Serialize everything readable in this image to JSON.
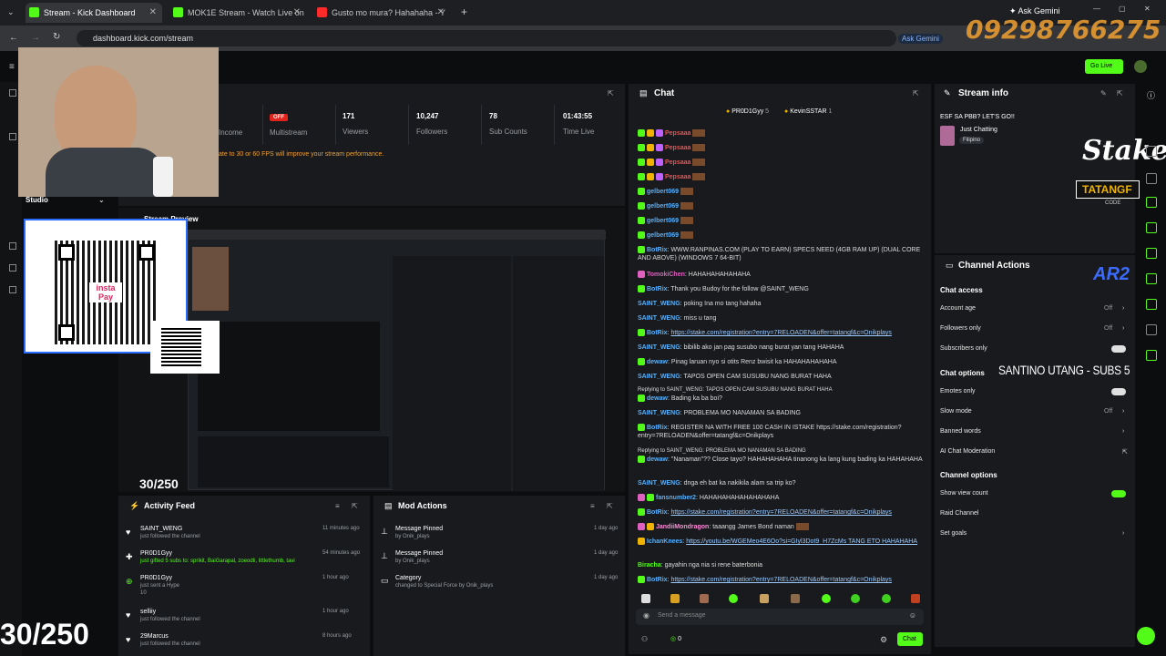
{
  "browser": {
    "tabs": [
      {
        "title": "Stream - Kick Dashboard"
      },
      {
        "title": "MOK1E Stream - Watch Live on"
      },
      {
        "title": "Gusto mo mura? Hahahaha - Y"
      }
    ],
    "url": "dashboard.kick.com/stream",
    "ask_gemini": "Ask Gemini",
    "ask_gemini_small": "Ask Gemini"
  },
  "overlay": {
    "phone": "09298766275",
    "qr_brand": "insta Pay",
    "counter_big": "30/250",
    "counter_small": "30/250",
    "stake": "Stake",
    "tatang": "TATANGF",
    "code": "CODE",
    "santino": "SANTINO UTANG - SUBS 5",
    "studio": "Studio"
  },
  "header": {
    "go_live": "Go Live"
  },
  "stats": [
    {
      "value": "",
      "label": "Income"
    },
    {
      "value": "OFF",
      "label": "Multistream"
    },
    {
      "value": "171",
      "label": "Viewers"
    },
    {
      "value": "10,247",
      "label": "Followers"
    },
    {
      "value": "78",
      "label": "Sub Counts"
    },
    {
      "value": "01:43:55",
      "label": "Time Live"
    }
  ],
  "warning": "ate to 30 or 60 FPS will improve your stream performance.",
  "preview": {
    "title": "Stream Preview"
  },
  "chat": {
    "title": "Chat",
    "pinned_users": [
      "PR0D1Gyy",
      "KevinSSTAR"
    ],
    "pinned_counts": [
      "5",
      "1"
    ],
    "messages": [
      {
        "user": "Pepsaaa",
        "text": ""
      },
      {
        "user": "Pepsaaa",
        "text": ""
      },
      {
        "user": "Pepsaaa",
        "text": ""
      },
      {
        "user": "Pepsaaa",
        "text": ""
      },
      {
        "user": "gelbert069",
        "text": ""
      },
      {
        "user": "gelbert069",
        "text": ""
      },
      {
        "user": "gelbert069",
        "text": ""
      },
      {
        "user": "gelbert069",
        "text": ""
      },
      {
        "user": "BotRix",
        "text": "WWW.RANPINAS.COM (PLAY TO EARN) SPECS NEED (4GB RAM UP) (DUAL CORE AND ABOVE) (WINDOWS 7 64-BIT)"
      },
      {
        "user": "TomokiChen",
        "text": "HAHAHAHAHAHAHA"
      },
      {
        "user": "BotRix",
        "text": "Thank you Budoy for the follow @SAINT_WENG"
      },
      {
        "user": "SAINT_WENG",
        "text": "poking Ina mo tang hahaha"
      },
      {
        "user": "SAINT_WENG",
        "text": "miss u tang"
      },
      {
        "user": "BotRix",
        "text": "https://stake.com/registration?entry=7RELOADEN&offer=tatangf&c=Onikplays"
      },
      {
        "user": "SAINT_WENG",
        "text": "bibilib ako jan pag susubo nang burat yan tang HAHAHA"
      },
      {
        "user": "dewaw",
        "text": "Pinag laruan nyo si otits Renz bwisit ka HAHAHAHAHAHA"
      },
      {
        "user": "SAINT_WENG",
        "text": "TAPOS OPEN CAM SUSUBU NANG BURAT HAHA"
      },
      {
        "user": "dewaw",
        "text": "Bading ka ba boi?"
      },
      {
        "user": "SAINT_WENG",
        "text": "PROBLEMA MO NANAMAN SA BADING"
      },
      {
        "user": "BotRix",
        "text": "REGISTER NA WITH FREE 100 CASH IN ISTAKE https://stake.com/registration?entry=7RELOADEN&offer=tatangf&c=Onikplays"
      },
      {
        "user": "dewaw",
        "text": "\"Nanaman\"?? Close tayo? HAHAHAHAHA tinanong ka lang kung bading ka HAHAHAHA"
      },
      {
        "user": "SAINT_WENG",
        "text": "dnga eh bat ka nakikila alam sa trip ko?"
      },
      {
        "user": "fansnumber2",
        "text": "HAHAHAHAHAHAHAHAHA"
      },
      {
        "user": "BotRix",
        "text": "https://stake.com/registration?entry=7RELOADEN&offer=tatangf&c=Onikplays"
      },
      {
        "user": "JandiiMondragon",
        "text": "taaangg James Bond naman"
      },
      {
        "user": "IchanKnees",
        "text": "https://youtu.be/WGEMeo4E6Oo?si=GIyl3Dot9_H7ZcMs TANG ETO HAHAHAHA"
      },
      {
        "user": "Biracha",
        "text": "gayahin nga nia si rene baterbonia"
      },
      {
        "user": "BotRix",
        "text": "https://stake.com/registration?entry=7RELOADEN&offer=tatangf&c=Onikplays"
      }
    ],
    "reply1": "Replying to SAINT_WENG: TAPOS OPEN CAM SUSUBU NANG BURAT HAHA",
    "reply2": "Replying to SAINT_WENG: PROBLEMA MO NANAMAN SA BADING",
    "placeholder": "Send a message",
    "points": "0",
    "send": "Chat"
  },
  "stream_info": {
    "title": "Stream info",
    "stream_title": "ESF SA PBB? LET'S GO!!",
    "category": "Just Chatting",
    "language": "Filipino"
  },
  "channel_actions": {
    "title": "Channel Actions",
    "chat_access": "Chat access",
    "account_age": {
      "label": "Account age",
      "value": "Off"
    },
    "followers_only": {
      "label": "Followers only",
      "value": "Off"
    },
    "subscribers_only": "Subscribers only",
    "chat_options": "Chat options",
    "emotes_only": "Emotes only",
    "slow_mode": {
      "label": "Slow mode",
      "value": "Off"
    },
    "banned_words": "Banned words",
    "ai_mod": "AI Chat Moderation",
    "channel_options": "Channel options",
    "show_view_count": "Show view count",
    "raid_channel": "Raid Channel",
    "set_goals": "Set goals"
  },
  "activity_feed": {
    "title": "Activity Feed",
    "items": [
      {
        "user": "SAINT_WENG",
        "sub": "just followed the channel",
        "time": "11 minutes ago"
      },
      {
        "user": "PR0D1Gyy",
        "sub": "just gifted 5 subs to: sprikit, BaiGarapal, zoeodli, littlethumb, tavi",
        "time": "54 minutes ago"
      },
      {
        "user": "PR0D1Gyy",
        "sub": "just sent a Hype",
        "time": "1 hour ago",
        "extra": "10"
      },
      {
        "user": "selliiy",
        "sub": "just followed the channel",
        "time": "1 hour ago"
      },
      {
        "user": "29Marcus",
        "sub": "just followed the channel",
        "time": "8 hours ago"
      }
    ]
  },
  "mod_actions": {
    "title": "Mod Actions",
    "items": [
      {
        "title": "Message Pinned",
        "sub": "by Onik_plays",
        "time": "1 day ago"
      },
      {
        "title": "Message Pinned",
        "sub": "by Onik_plays",
        "time": "1 day ago"
      },
      {
        "title": "Category",
        "sub": "changed to Special Force by Onik_plays",
        "time": "1 day ago"
      }
    ]
  }
}
